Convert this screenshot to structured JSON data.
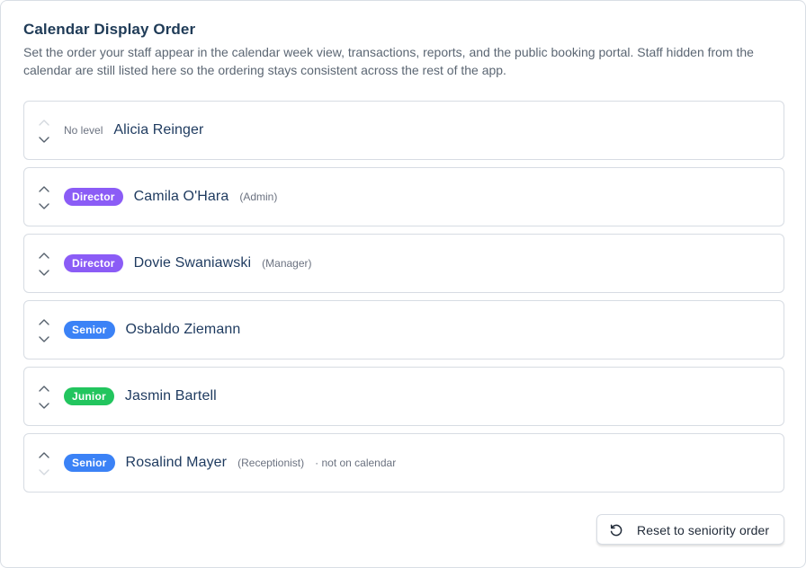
{
  "header": {
    "title": "Calendar Display Order",
    "description": "Set the order your staff appear in the calendar week view, transactions, reports, and the public booking portal. Staff hidden from the calendar are still listed here so the ordering stays consistent across the rest of the app."
  },
  "staff": [
    {
      "level": "No level",
      "level_style": "none",
      "name": "Alicia Reinger",
      "role": "",
      "note": "",
      "up_enabled": false,
      "down_enabled": true
    },
    {
      "level": "Director",
      "level_style": "director",
      "name": "Camila O'Hara",
      "role": "(Admin)",
      "note": "",
      "up_enabled": true,
      "down_enabled": true
    },
    {
      "level": "Director",
      "level_style": "director",
      "name": "Dovie Swaniawski",
      "role": "(Manager)",
      "note": "",
      "up_enabled": true,
      "down_enabled": true
    },
    {
      "level": "Senior",
      "level_style": "senior",
      "name": "Osbaldo Ziemann",
      "role": "",
      "note": "",
      "up_enabled": true,
      "down_enabled": true
    },
    {
      "level": "Junior",
      "level_style": "junior",
      "name": "Jasmin Bartell",
      "role": "",
      "note": "",
      "up_enabled": true,
      "down_enabled": true
    },
    {
      "level": "Senior",
      "level_style": "senior",
      "name": "Rosalind Mayer",
      "role": "(Receptionist)",
      "note": "· not on calendar",
      "up_enabled": true,
      "down_enabled": false
    }
  ],
  "actions": {
    "reset_label": "Reset to seniority order",
    "reset_icon": "rotate-ccw-icon"
  },
  "colors": {
    "director": "#8b5cf6",
    "senior": "#3b82f6",
    "junior": "#22c55e",
    "text_primary": "#1e3a5f"
  },
  "icons": {
    "move_up": "chevron-up-icon",
    "move_down": "chevron-down-icon"
  }
}
